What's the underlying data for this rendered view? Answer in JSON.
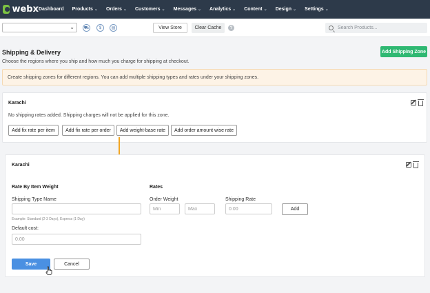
{
  "brand": {
    "name": "webx"
  },
  "nav": [
    {
      "label": "Dashboard",
      "has_menu": false
    },
    {
      "label": "Products",
      "has_menu": true
    },
    {
      "label": "Orders",
      "has_menu": true
    },
    {
      "label": "Customers",
      "has_menu": true
    },
    {
      "label": "Messages",
      "has_menu": true
    },
    {
      "label": "Analytics",
      "has_menu": true
    },
    {
      "label": "Content",
      "has_menu": true
    },
    {
      "label": "Design",
      "has_menu": true
    },
    {
      "label": "Settings",
      "has_menu": true
    }
  ],
  "toolbar": {
    "store_select_value": "",
    "view_store_label": "View Store",
    "clear_cache_label": "Clear Cache",
    "help_glyph": "?",
    "search_placeholder": "Search Products..."
  },
  "header": {
    "title": "Shipping & Delivery",
    "subtitle": "Choose the regions where you ship and how much you charge for shipping at checkout.",
    "add_zone_label": "Add Shipping Zone"
  },
  "info": {
    "text": "Create shipping zones for different regions. You can add multiple shipping types and rates under your shipping zones."
  },
  "zone_card": {
    "title": "Karachi",
    "note": "No shipping rates added. Shipping charges will not be applied for this zone.",
    "buttons": [
      "Add fix rate per item",
      "Add fix rate per order",
      "Add weight-base rate",
      "Add order amount wise rate"
    ]
  },
  "rate_form": {
    "title": "Karachi",
    "left_section": "Rate By Item Weight",
    "right_section": "Rates",
    "type_name_label": "Shipping Type Name",
    "type_name_value": "",
    "type_name_hint": "Example: Standard (2-3 Days), Express (1 Day)",
    "default_cost_label": "Default cost:",
    "default_cost_placeholder": "0.00",
    "order_weight_label": "Order Weight",
    "min_placeholder": "Min",
    "max_placeholder": "Max",
    "shipping_rate_label": "Shipping Rate",
    "shipping_rate_placeholder": "0.00",
    "add_label": "Add",
    "save_label": "Save",
    "cancel_label": "Cancel"
  },
  "colors": {
    "nav_bg": "#2d3a4a",
    "brand_green": "#7cc242",
    "add_zone_green": "#2fb872",
    "save_blue": "#4a90e2",
    "arrow_orange": "#f2a521",
    "info_bg": "#fdf3e6"
  }
}
